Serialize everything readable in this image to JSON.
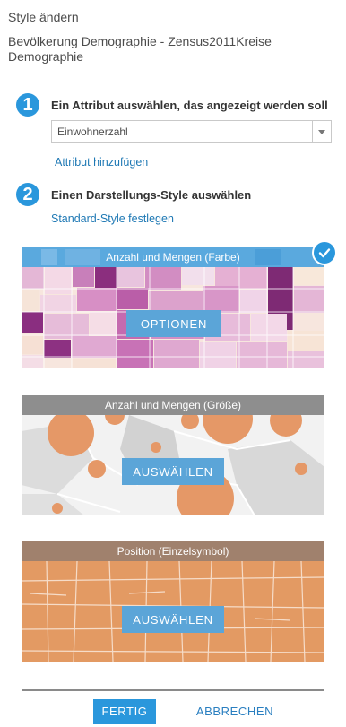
{
  "panel": {
    "title": "Style ändern",
    "layer_name": "Bevölkerung Demographie - Zensus2011Kreise Demographie"
  },
  "step1": {
    "number": "1",
    "label": "Ein Attribut auswählen, das angezeigt werden soll",
    "select_value": "Einwohnerzahl",
    "add_attribute_link": "Attribut hinzufügen"
  },
  "step2": {
    "number": "2",
    "label": "Einen Darstellungs-Style auswählen",
    "default_style_link": "Standard-Style festlegen"
  },
  "styles": [
    {
      "title": "Anzahl und Mengen (Farbe)",
      "button": "OPTIONEN",
      "selected": true
    },
    {
      "title": "Anzahl und Mengen (Größe)",
      "button": "AUSWÄHLEN",
      "selected": false
    },
    {
      "title": "Position (Einzelsymbol)",
      "button": "AUSWÄHLEN",
      "selected": false
    }
  ],
  "footer": {
    "done_label": "FERTIG",
    "cancel_label": "ABBRECHEN"
  },
  "colors": {
    "accent": "#2a97dc",
    "color_map_purple": "#b0569e",
    "size_map_orange": "#e59867",
    "single_symbol_orange": "#e39a63"
  },
  "icons": {
    "selected_check": "check-icon",
    "dropdown": "chevron-down-icon"
  }
}
